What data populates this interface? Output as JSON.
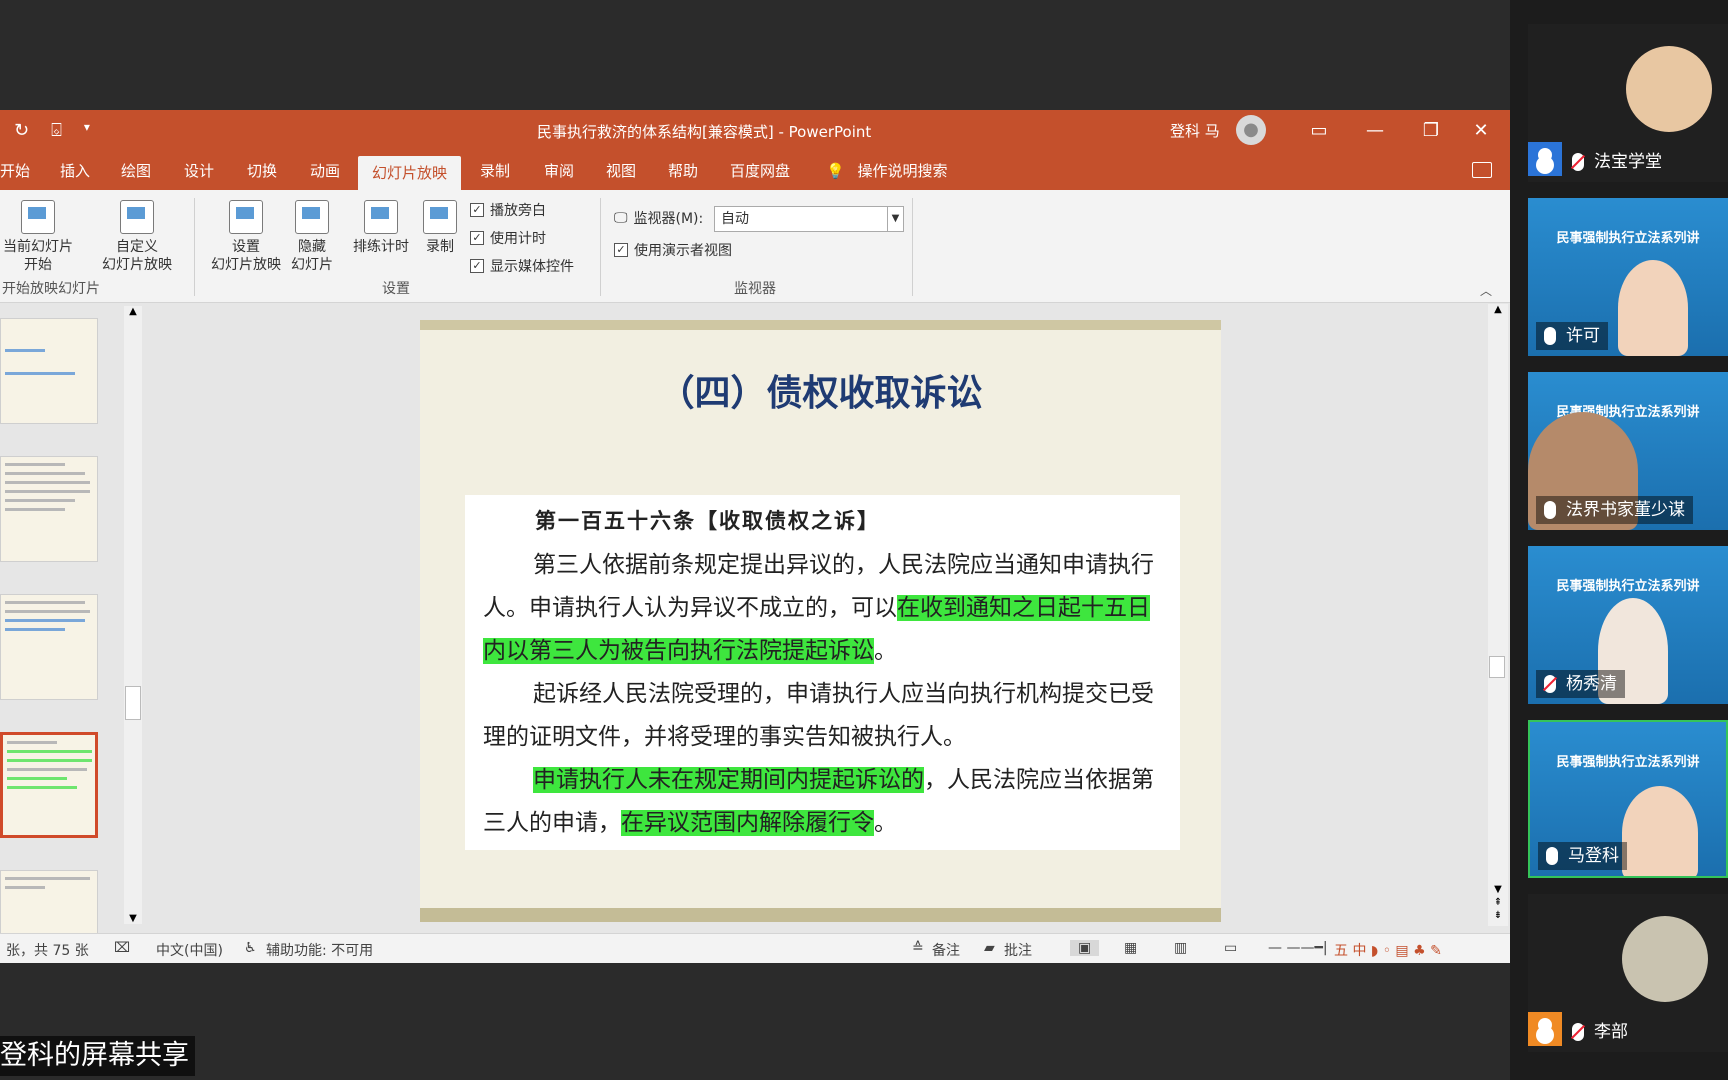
{
  "window": {
    "title": "民事执行救济的体系结构[兼容模式] - PowerPoint",
    "user_name": "登科 马"
  },
  "tabs": [
    "开始",
    "插入",
    "绘图",
    "设计",
    "切换",
    "动画",
    "幻灯片放映",
    "录制",
    "审阅",
    "视图",
    "帮助",
    "百度网盘"
  ],
  "tab_search": "操作说明搜索",
  "ribbon": {
    "from_current": "当前幻灯片\n开始",
    "custom_show": "自定义\n幻灯片放映",
    "group_start": "开始放映幻灯片",
    "setup_show": "设置\n幻灯片放映",
    "hide_slide": "隐藏\n幻灯片",
    "rehearse": "排练计时",
    "record": "录制",
    "chk_narration": "播放旁白",
    "chk_timing": "使用计时",
    "chk_media": "显示媒体控件",
    "group_setup": "设置",
    "monitor_label": "监视器(M):",
    "monitor_value": "自动",
    "chk_presenter": "使用演示者视图",
    "group_monitor": "监视器"
  },
  "slide": {
    "title": "（四）债权收取诉讼",
    "article": "第一百五十六条【收取债权之诉】",
    "p1_a": "第三人依据前条规定提出异议的，人民法院应当通知申请执行人。申请执行人认为异议不成立的，可以",
    "p1_hl": "在收到通知之日起十五日内以第三人为被告向执行法院提起诉讼",
    "p1_b": "。",
    "p2": "起诉经人民法院受理的，申请执行人应当向执行机构提交已受理的证明文件，并将受理的事实告知被执行人。",
    "p3_hl1": "申请执行人未在规定期间内提起诉讼的",
    "p3_a": "，人民法院应当依据第三人的申请，",
    "p3_hl2": "在异议范围内解除履行令",
    "p3_b": "。"
  },
  "status": {
    "slide_count": "张，共 75 张",
    "language": "中文(中国)",
    "accessibility": "辅助功能: 不可用",
    "notes": "备注",
    "comments": "批注"
  },
  "participants": [
    {
      "name": "法宝学堂"
    },
    {
      "name": "许可",
      "banner": "民事强制执行立法系列讲"
    },
    {
      "name": "法界书家董少谋",
      "banner": "民事强制执行立法系列讲"
    },
    {
      "name": "杨秀清",
      "banner": "民事强制执行立法系列讲"
    },
    {
      "name": "马登科",
      "banner": "民事强制执行立法系列讲"
    },
    {
      "name": "李部"
    }
  ],
  "share_label": "登科的屏幕共享",
  "colors": {
    "ppt_accent": "#c4502c",
    "highlight": "#3ee63e",
    "slide_title": "#1f3b73",
    "active_speaker": "#35c45a"
  }
}
